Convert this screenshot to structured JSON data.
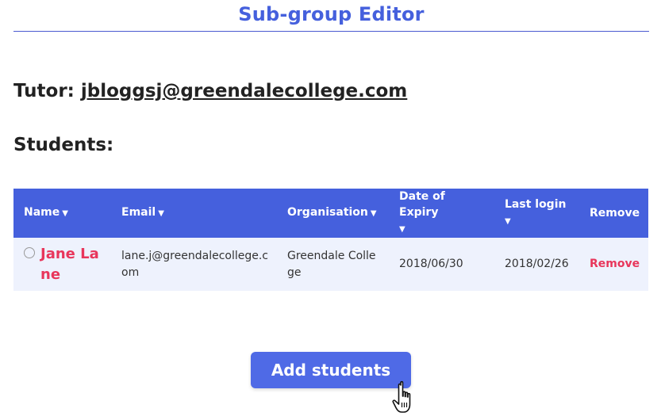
{
  "header": {
    "title": "Sub-group Editor"
  },
  "tutor": {
    "label": "Tutor:",
    "email": "jbloggsj@greendalecollege.com"
  },
  "students": {
    "heading": "Students:",
    "columns": {
      "name": "Name",
      "email": "Email",
      "organisation": "Organisation",
      "expiry": "Date of Expiry",
      "last_login": "Last login",
      "remove": "Remove"
    },
    "rows": [
      {
        "name": "Jane Lane",
        "email": "lane.j@greendalecollege.com",
        "organisation": "Greendale College",
        "expiry": "2018/06/30",
        "last_login": "2018/02/26",
        "remove": "Remove"
      }
    ]
  },
  "actions": {
    "add_students": "Add students"
  },
  "colors": {
    "accent": "#4560dd",
    "danger": "#e8365b",
    "row_bg": "#eef2fd"
  },
  "icons": {
    "sort": "caret-down-icon",
    "cursor": "hand-pointer-icon",
    "select": "radio-icon"
  }
}
